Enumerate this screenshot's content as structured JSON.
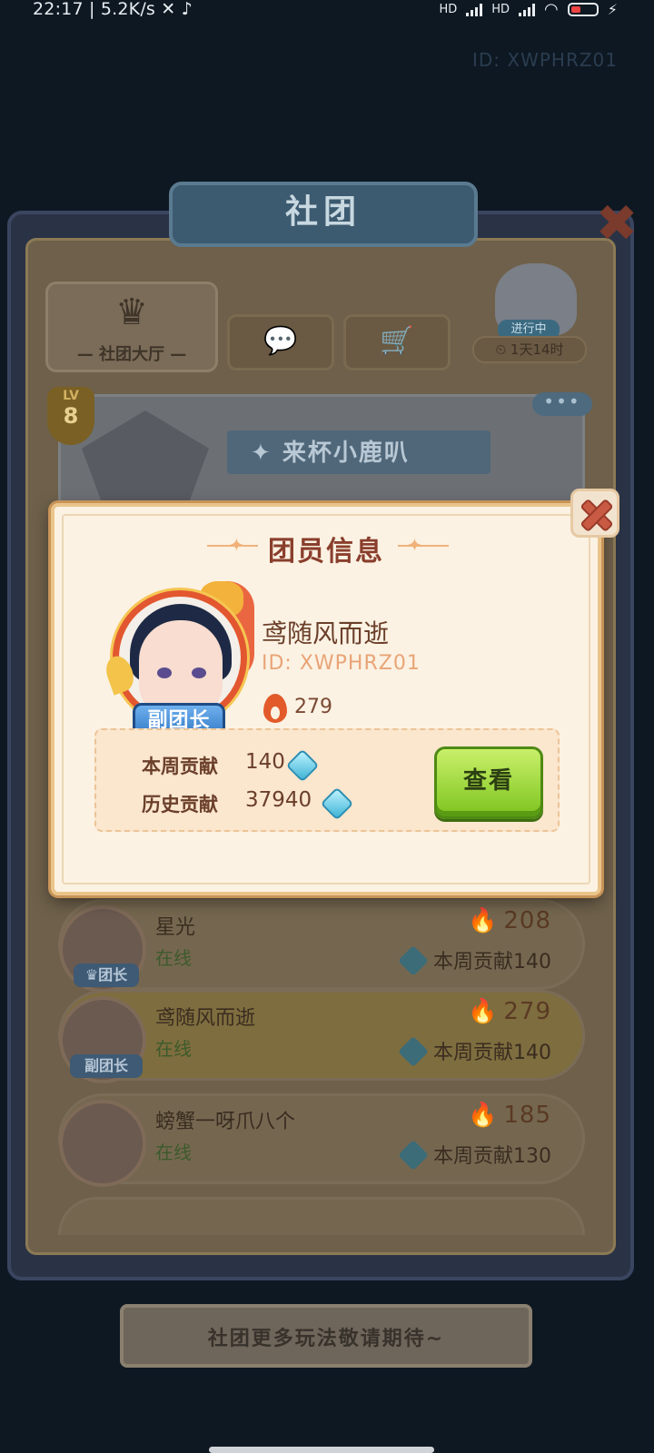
{
  "status_bar": {
    "time": "22:17",
    "net_speed": "5.2K/s",
    "hd_label": "HD",
    "battery": "22"
  },
  "top_id": "ID: XWPHRZ01",
  "hall": {
    "title": "社团",
    "tabs": {
      "hall_label": "— 社团大厅 —"
    },
    "event": {
      "status": "进行中",
      "countdown": "1天14时"
    },
    "club": {
      "level_prefix": "LV",
      "level": "8",
      "name": "来杯小鹿叭",
      "more": "•••"
    },
    "members": [
      {
        "name": "星光",
        "status": "在线",
        "power": "208",
        "weekly": "本周贡献140",
        "role": "团长"
      },
      {
        "name": "鸢随风而逝",
        "status": "在线",
        "power": "279",
        "weekly": "本周贡献140",
        "role": "副团长"
      },
      {
        "name": "螃蟹一呀爪八个",
        "status": "在线",
        "power": "185",
        "weekly": "本周贡献130",
        "role": ""
      }
    ],
    "bottom_banner": "社团更多玩法敬请期待~"
  },
  "modal": {
    "title": "团员信息",
    "player": {
      "name": "鸢随风而逝",
      "id": "ID: XWPHRZ01",
      "power": "279",
      "role": "副团长"
    },
    "contribution": {
      "weekly_label": "本周贡献",
      "weekly_value": "140",
      "history_label": "历史贡献",
      "history_value": "37940"
    },
    "view_button": "查看"
  },
  "colors": {
    "accent_title": "#8a3e2c",
    "button_green": "#7dc41e",
    "role_blue": "#3279c5"
  }
}
